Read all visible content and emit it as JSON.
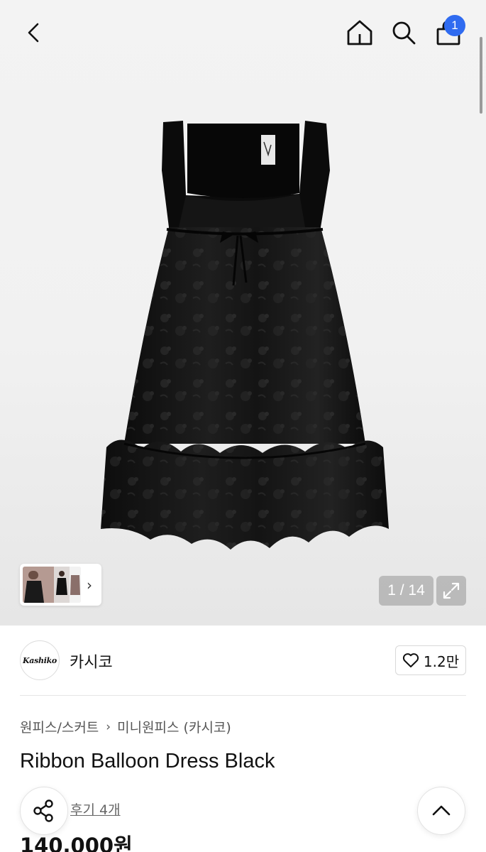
{
  "header": {
    "back_icon": "chevron-left-icon",
    "home_icon": "home-icon",
    "search_icon": "search-icon",
    "cart_icon": "shopping-bag-icon",
    "cart_count": "1",
    "badge_color": "#2f6bf0"
  },
  "gallery": {
    "counter": "1 / 14",
    "thumbnail_next_icon": "chevron-right-icon",
    "expand_icon": "expand-icon"
  },
  "brand": {
    "logo_text": "Kashiko",
    "name": "카시코",
    "like_icon": "heart-outline-icon",
    "like_count": "1.2만"
  },
  "breadcrumb": {
    "items": [
      "원피스/스커트",
      "미니원피스 (카시코)"
    ],
    "separator": "›"
  },
  "product": {
    "title": "Ribbon Balloon Dress Black",
    "review_link": "후기 4개",
    "price": "140,000원"
  },
  "actions": {
    "share_icon": "share-icon",
    "scroll_top_icon": "chevron-up-icon"
  }
}
